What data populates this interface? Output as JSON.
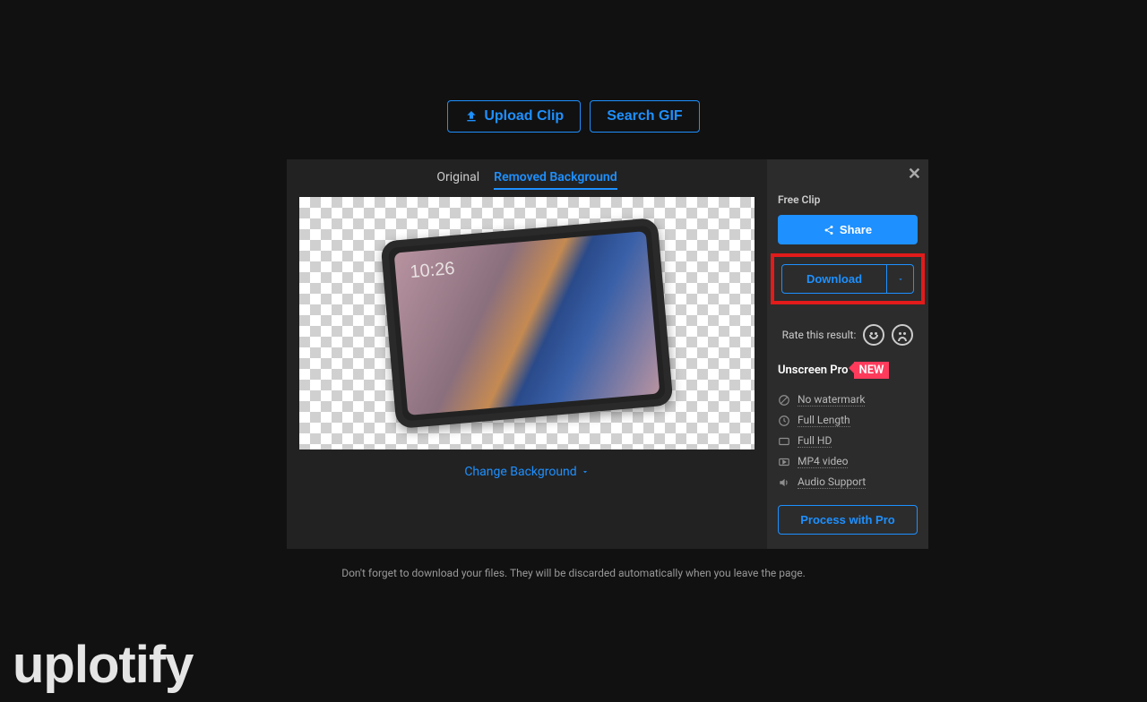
{
  "top": {
    "upload_label": "Upload Clip",
    "search_label": "Search GIF"
  },
  "tabs": {
    "original": "Original",
    "removed": "Removed Background"
  },
  "preview": {
    "tablet_time": "10:26"
  },
  "change_bg": "Change Background",
  "side": {
    "free_clip": "Free Clip",
    "share": "Share",
    "download": "Download",
    "rate": "Rate this result:",
    "pro_title": "Unscreen Pro",
    "new": "NEW",
    "features": {
      "f1": "No watermark",
      "f2": "Full Length",
      "f3": "Full HD",
      "f4": "MP4 video",
      "f5": "Audio Support"
    },
    "process_pro": "Process with Pro"
  },
  "footer": "Don't forget to download your files. They will be discarded automatically when you leave the page.",
  "watermark": "uplotify"
}
